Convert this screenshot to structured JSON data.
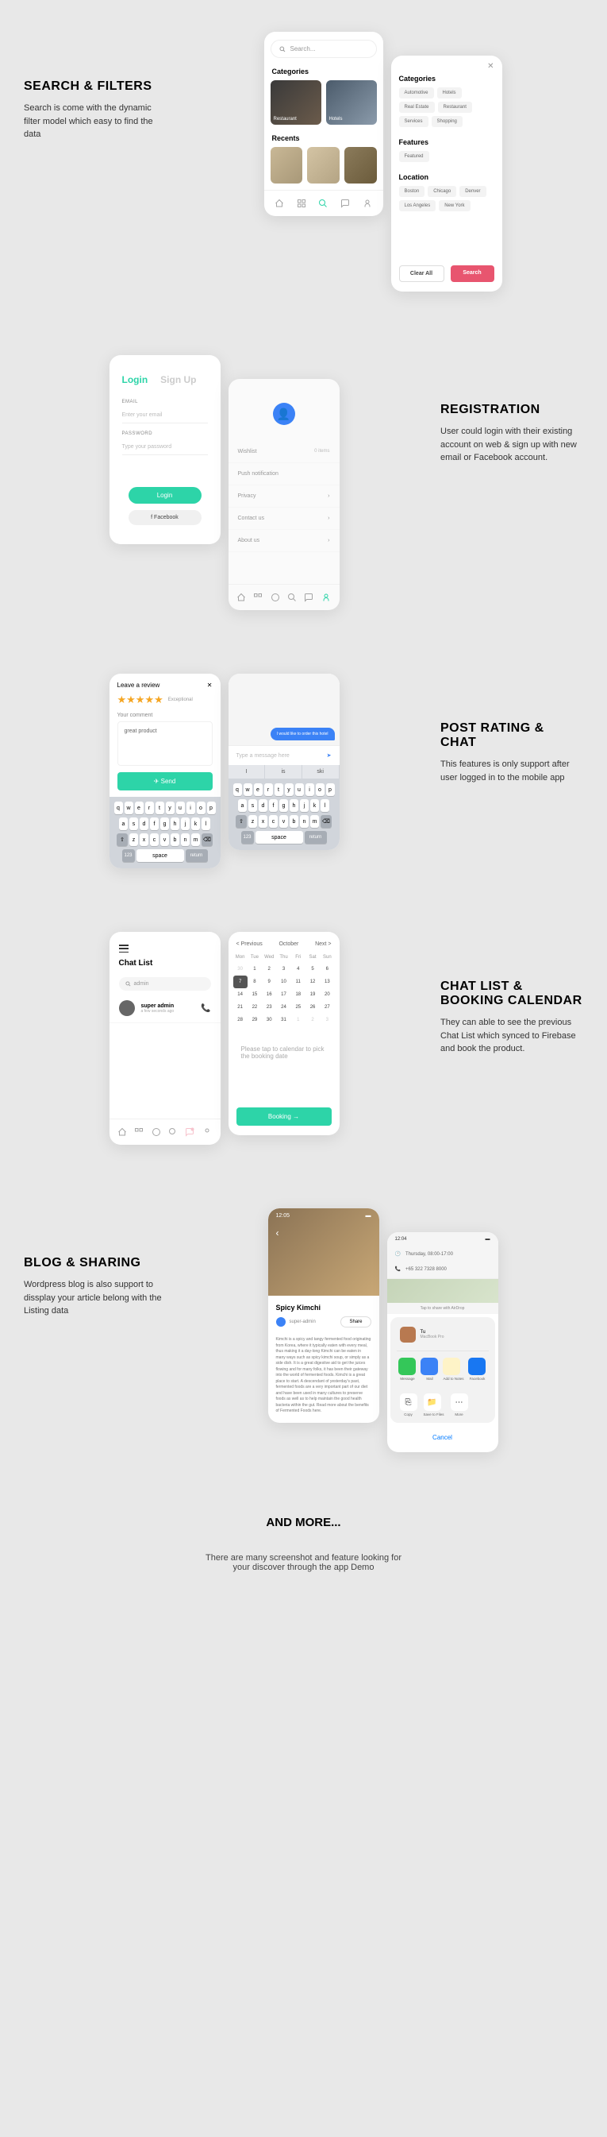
{
  "s1": {
    "title": "SEARCH & FILTERS",
    "desc": "Search is come with the dynamic filter model which easy to find the data",
    "search_placeholder": "Search...",
    "cat_label": "Categories",
    "cats": [
      "Restaurant",
      "Hotels"
    ],
    "rec_label": "Recents",
    "filter_cat_label": "Categories",
    "filter_cats": [
      "Automotive",
      "Hotels",
      "Real Estate",
      "Restaurant",
      "Services",
      "Shopping"
    ],
    "feat_label": "Features",
    "feats": [
      "Featured"
    ],
    "loc_label": "Location",
    "locs": [
      "Boston",
      "Chicago",
      "Denver",
      "Los Angeles",
      "New York"
    ],
    "clear": "Clear All",
    "search_btn": "Search"
  },
  "s2": {
    "title": "REGISTRATION",
    "desc": "User could login with their existing account on web & sign up with new email or Facebook account.",
    "login": "Login",
    "signup": "Sign Up",
    "email_label": "EMAIL",
    "email_ph": "Enter your email",
    "pass_label": "PASSWORD",
    "pass_ph": "Type your password",
    "login_btn": "Login",
    "fb_btn": "f  Facebook",
    "menu": {
      "wishlist": "Wishlist",
      "wishlist_tag": "0 items",
      "push": "Push notification",
      "privacy": "Privacy",
      "contact": "Contact us",
      "about": "About us"
    }
  },
  "s3": {
    "title": "POST RATING & CHAT",
    "desc": "This features is only support after user logged in to the mobile app",
    "review_title": "Leave a review",
    "rating_txt": "Exceptional",
    "comment_label": "Your comment",
    "comment_val": "great product",
    "send": "Send",
    "chat_bubble": "I would like to order this hotel",
    "chat_input": "Type a message here",
    "kbd_r1": [
      "q",
      "w",
      "e",
      "r",
      "t",
      "y",
      "u",
      "i",
      "o",
      "p"
    ],
    "kbd_r2": [
      "a",
      "s",
      "d",
      "f",
      "g",
      "h",
      "j",
      "k",
      "l"
    ],
    "kbd_r3": [
      "z",
      "x",
      "c",
      "v",
      "b",
      "n",
      "m"
    ],
    "kbd_123": "123",
    "kbd_space": "space",
    "kbd_return": "return",
    "auto": [
      "I",
      "is",
      "ski"
    ]
  },
  "s4": {
    "title": "CHAT LIST & BOOKING CALENDAR",
    "desc": "They can able to see the previous Chat List which synced to Firebase and book the product.",
    "chat_list": "Chat List",
    "search_ph": "admin",
    "user": "super admin",
    "user_sub": "a few seconds ago",
    "prev": "< Previous",
    "month": "October",
    "next": "Next >",
    "days": [
      "Mon",
      "Tue",
      "Wed",
      "Thu",
      "Fri",
      "Sat",
      "Sun"
    ],
    "cal_msg": "Please tap to calendar to pick the booking date",
    "book": "Booking"
  },
  "s5": {
    "title": "BLOG & SHARING",
    "desc": "Wordpress blog is also support to dissplay your article belong with the Listing data",
    "time": "12:05",
    "blog_title": "Spicy Kimchi",
    "author": "super-admin",
    "share": "Share",
    "body": "Kimchi is a spicy and tangy fermented food originating from Korea, where it typically eaten with every meal, thus making it a day-long Kimchi can be eaten in many ways such as spicy kimchi soup, or simply as a side dish. It is a great digestive aid to get the juices flowing and for many folks, it has been their gateway into the world of fermented foods. Kimchi is a great place to start. A descendant of yesterday's past, fermented foods are a very important part of our diet and have been used in many cultures to preserve foods as well as to help maintain the good health bacteria within the gut. Read more about the benefits of Fermented Foods here.",
    "share_time": "12:04",
    "date": "Thursday, 08:00-17:00",
    "phone": "+65 322 7328 8000",
    "tap_share": "Tap to share with AirDrop",
    "airdrop_name": "Tu",
    "airdrop_sub": "MacBook Pro",
    "apps": [
      "Message",
      "Mail",
      "Add to Notes",
      "Facebook"
    ],
    "acts": [
      "Copy",
      "Save to Files",
      "More"
    ],
    "cancel": "Cancel"
  },
  "s6": {
    "title": "AND MORE...",
    "desc": "There are many screenshot and feature looking for your discover through the app Demo"
  }
}
